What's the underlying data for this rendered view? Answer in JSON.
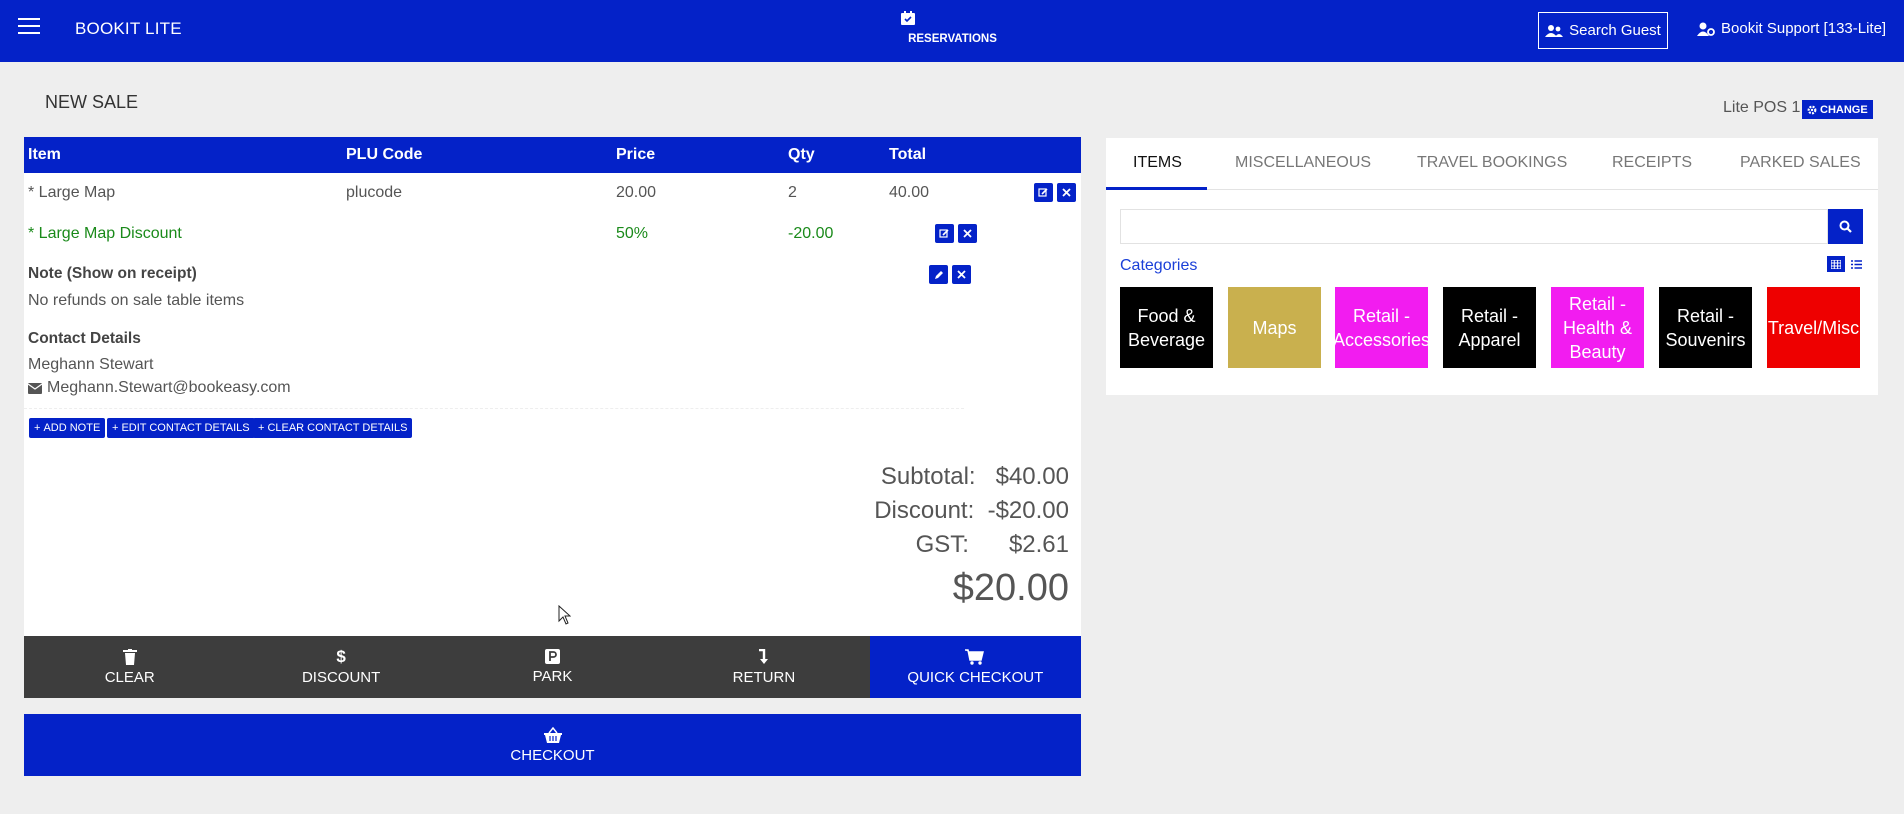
{
  "topbar": {
    "app_title": "BOOKIT LITE",
    "reservations_label": "RESERVATIONS",
    "search_guest_label": "Search Guest",
    "user_label": "Bookit Support [133-Lite]"
  },
  "page": {
    "title": "NEW SALE",
    "pos_label": "Lite POS 1",
    "change_label": "CHANGE"
  },
  "sale_table": {
    "headers": [
      "Item",
      "PLU Code",
      "Price",
      "Qty",
      "Total"
    ],
    "rows": [
      {
        "item": "* Large Map",
        "plu": "plucode",
        "price": "20.00",
        "qty": "2",
        "total": "40.00"
      },
      {
        "item": "* Large Map Discount",
        "price": "50%",
        "qty": "-20.00"
      }
    ],
    "note_label": "Note (Show on receipt)",
    "note_text": "No refunds on sale table items",
    "contact_label": "Contact Details",
    "contact_name": "Meghann Stewart",
    "contact_email": "Meghann.Stewart@bookeasy.com"
  },
  "buttons": {
    "add_note": "ADD NOTE",
    "edit_contact": "EDIT CONTACT DETAILS",
    "clear_contact": "CLEAR CONTACT DETAILS"
  },
  "totals": {
    "subtotal_label": "Subtotal:",
    "subtotal_value": "$40.00",
    "discount_label": "Discount:",
    "discount_value": "-$20.00",
    "gst_label": "GST:",
    "gst_value": "$2.61",
    "grand_total": "$20.00"
  },
  "actions": {
    "clear": "CLEAR",
    "discount": "DISCOUNT",
    "park": "PARK",
    "return": "RETURN",
    "quick_checkout": "QUICK CHECKOUT",
    "checkout": "CHECKOUT"
  },
  "right_panel": {
    "tabs": [
      "ITEMS",
      "MISCELLANEOUS",
      "TRAVEL BOOKINGS",
      "RECEIPTS",
      "PARKED SALES"
    ],
    "search_placeholder": "",
    "categories_label": "Categories",
    "categories": [
      {
        "label": "Food & Beverage",
        "color": "#000000"
      },
      {
        "label": "Maps",
        "color": "#c9b04e"
      },
      {
        "label": "Retail - Accessories",
        "color": "#f21cf0"
      },
      {
        "label": "Retail - Apparel",
        "color": "#000000"
      },
      {
        "label": "Retail - Health & Beauty",
        "color": "#f21cf0"
      },
      {
        "label": "Retail - Souvenirs",
        "color": "#000000"
      },
      {
        "label": "Travel/Misc",
        "color": "#ee0000"
      }
    ]
  },
  "colors": {
    "primary": "#0422c8",
    "discount_text": "#1a8a1a",
    "action_dark": "#3d3d3d"
  }
}
